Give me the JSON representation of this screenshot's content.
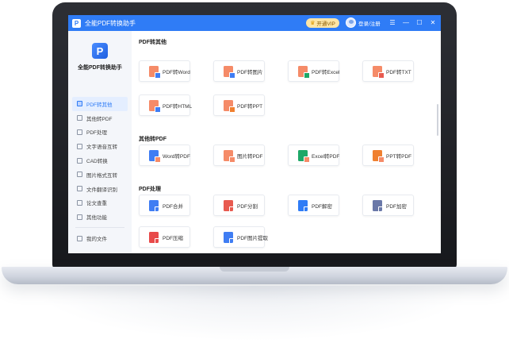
{
  "window": {
    "title": "全能PDF转换助手",
    "vip_label": "开通VIP",
    "login_label": "登录/注册",
    "menu_glyph": "☰",
    "minimize_glyph": "—",
    "maximize_glyph": "☐",
    "close_glyph": "✕"
  },
  "brand": {
    "logo_text": "P",
    "name": "全能PDF转换助手"
  },
  "sidebar": {
    "items": [
      {
        "label": "PDF转其他",
        "active": true
      },
      {
        "label": "其他转PDF"
      },
      {
        "label": "PDF处理"
      },
      {
        "label": "文字语音互转"
      },
      {
        "label": "CAD转换"
      },
      {
        "label": "图片格式互转"
      },
      {
        "label": "文件翻译识别"
      },
      {
        "label": "论文查重"
      },
      {
        "label": "其他功能"
      }
    ],
    "footer_item": {
      "label": "我的文件"
    }
  },
  "sections": [
    {
      "title": "PDF转其他",
      "cards": [
        {
          "label": "PDF转Word",
          "icon": "pdf-to-word-icon",
          "color": "#f58b68",
          "badge": "#3f7df3"
        },
        {
          "label": "PDF转图片",
          "icon": "pdf-to-image-icon",
          "color": "#f58b68",
          "badge": "#3f7df3"
        },
        {
          "label": "PDF转Excel",
          "icon": "pdf-to-excel-icon",
          "color": "#f58b68",
          "badge": "#1ea868"
        },
        {
          "label": "PDF转TXT",
          "icon": "pdf-to-txt-icon",
          "color": "#f58b68",
          "badge": "#e85a4f"
        },
        {
          "label": "PDF转HTML",
          "icon": "pdf-to-html-icon",
          "color": "#f58b68",
          "badge": "#3f7df3"
        },
        {
          "label": "PDF转PPT",
          "icon": "pdf-to-ppt-icon",
          "color": "#f58b68",
          "badge": "#f08030"
        }
      ]
    },
    {
      "title": "其他转PDF",
      "cards": [
        {
          "label": "Word转PDF",
          "icon": "word-to-pdf-icon",
          "color": "#3f7df3",
          "badge": "#f58b68"
        },
        {
          "label": "图片转PDF",
          "icon": "image-to-pdf-icon",
          "color": "#f58b68",
          "badge": "#f58b68"
        },
        {
          "label": "Excel转PDF",
          "icon": "excel-to-pdf-icon",
          "color": "#1ea868",
          "badge": "#f58b68"
        },
        {
          "label": "PPT转PDF",
          "icon": "ppt-to-pdf-icon",
          "color": "#f08030",
          "badge": "#f58b68"
        }
      ]
    },
    {
      "title": "PDF处理",
      "cards": [
        {
          "label": "PDF合并",
          "icon": "pdf-merge-icon",
          "color": "#3f7df3",
          "badge": ""
        },
        {
          "label": "PDF分割",
          "icon": "pdf-split-icon",
          "color": "#e85a4f",
          "badge": ""
        },
        {
          "label": "PDF解密",
          "icon": "pdf-decrypt-icon",
          "color": "#2f7cf6",
          "badge": ""
        },
        {
          "label": "PDF加密",
          "icon": "pdf-encrypt-icon",
          "color": "#6a78a8",
          "badge": ""
        },
        {
          "label": "PDF压缩",
          "icon": "pdf-compress-icon",
          "color": "#e84a4a",
          "badge": ""
        },
        {
          "label": "PDF图片提取",
          "icon": "pdf-image-extract-icon",
          "color": "#3f7df3",
          "badge": ""
        }
      ]
    }
  ]
}
